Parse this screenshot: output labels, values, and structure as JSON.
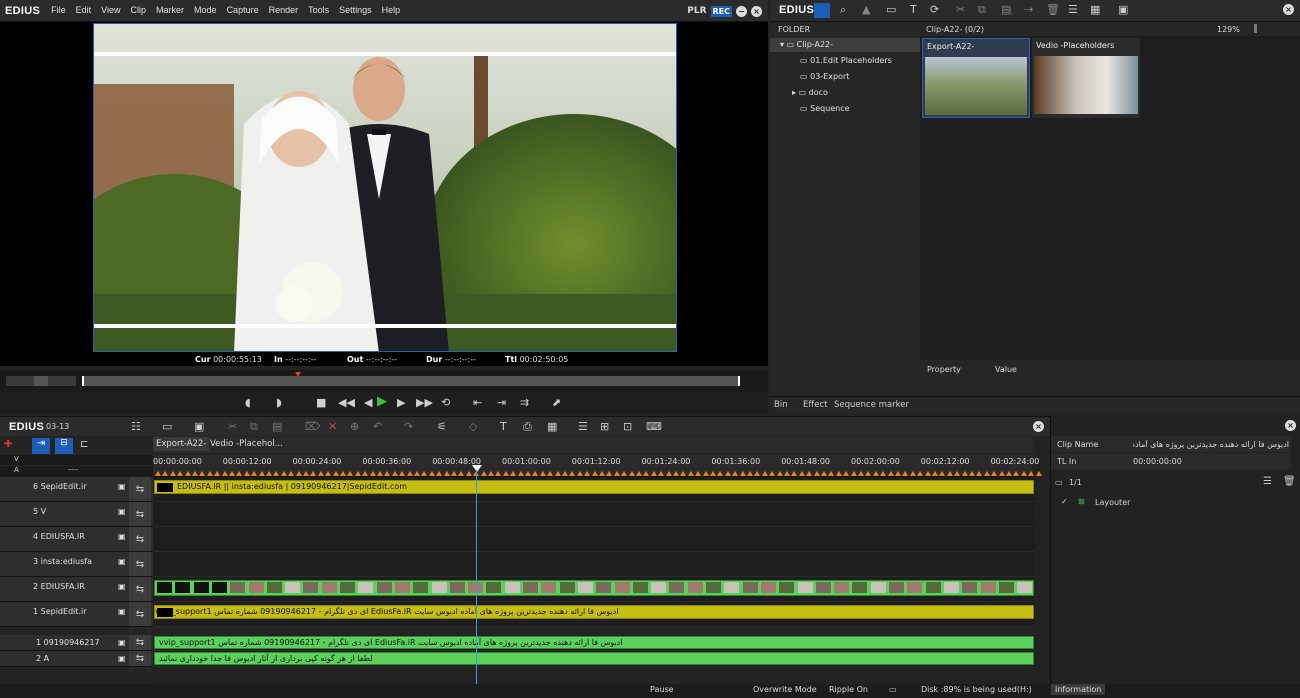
{
  "app": {
    "logo": "EDIUS"
  },
  "menu": [
    "File",
    "Edit",
    "View",
    "Clip",
    "Marker",
    "Mode",
    "Capture",
    "Render",
    "Tools",
    "Settings",
    "Help"
  ],
  "player": {
    "plr": "PLR",
    "rec": "REC",
    "cur_label": "Cur",
    "cur": "00:00:55:13",
    "in_label": "In",
    "in": "--:--:--:--",
    "out_label": "Out",
    "out": "--:--:--:--",
    "dur_label": "Dur",
    "dur": "--:--:--:--",
    "ttl_label": "Ttl",
    "ttl": "00:02:50:05"
  },
  "bin": {
    "logo": "EDIUS",
    "folder_label": "FOLDER",
    "clip_header": "Clip-A22- (0/2)",
    "zoom": "129%",
    "tree": [
      {
        "label": "Clip-A22-"
      },
      {
        "label": "01.Edit Placeholders"
      },
      {
        "label": "03-Export"
      },
      {
        "label": "doco"
      },
      {
        "label": "Sequence"
      }
    ],
    "clips": [
      {
        "name": "Export-A22-"
      },
      {
        "name": "Vedio -Placeholders"
      }
    ],
    "property_label": "Property",
    "value_label": "Value",
    "tabs": [
      "Bin",
      "Effect",
      "Sequence marker"
    ]
  },
  "timeline": {
    "logo": "EDIUS",
    "seq": "03-13",
    "tabs": [
      "Export-A22-",
      "Vedio -Placehol..."
    ],
    "ruler": [
      "00:00:00:00",
      "00:00:12:00",
      "00:00:24:00",
      "00:00:36:00",
      "00:00:48:00",
      "00:01:00:00",
      "00:01:12:00",
      "00:01:24:00",
      "00:01:36:00",
      "00:01:48:00",
      "00:02:00:00",
      "00:02:12:00",
      "00:02:24:00"
    ],
    "vlabel": "V",
    "alabel": "A",
    "aval": "----",
    "tracks": [
      {
        "name": "6 SepidEdit.ir",
        "clip": "EDIUSFA.IR || insta:ediusfa |  09190946217|SepidEdit.com"
      },
      {
        "name": "5 V",
        "clip": ""
      },
      {
        "name": "4 EDIUSFA.IR",
        "clip": ""
      },
      {
        "name": "3 insta:ediusfa",
        "clip": ""
      },
      {
        "name": "2 EDIUSFA.IR",
        "clip": ""
      },
      {
        "name": "1 SepidEdit.ir",
        "clip": "ادیوس فا ارائه دهنده جدیدترین پروژه های آماده ادیوس سایت  EdiusFa.iR  ای دی تلگرام  -  09190946217  شماره تماس  vvip_support1"
      },
      {
        "name": "1 09190946217",
        "clip": "ادیوس فا ارائه دهنده جدیدترین پروژه های آماده ادیوس سایت  EdiusFa.iR  ای دی تلگرام  -  09190946217  شماره تماس  vvip_support1"
      },
      {
        "name": "2 A",
        "clip": "لطفا از هر گونه کپی برداری از آثار ادیوس فا جدا خودداری نمائید"
      }
    ]
  },
  "info": {
    "clip_name_label": "Clip Name",
    "clip_name": "ادیوس فا ارائه دهنده جدیدترین پروژه های آماده",
    "tl_in_label": "TL In",
    "tl_in": "00:00:00:00",
    "page": "1/1",
    "layer": "Layouter",
    "tab": "Information"
  },
  "status": {
    "pause": "Pause",
    "mode": "Overwrite Mode",
    "ripple": "Ripple On",
    "disk": "Disk :89% is being used(H:)"
  }
}
